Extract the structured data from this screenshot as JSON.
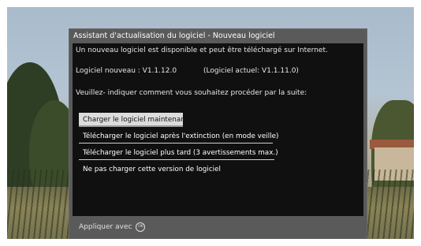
{
  "dialog": {
    "title": "Assistant d'actualisation du logiciel - Nouveau logiciel",
    "message": "Un nouveau logiciel est disponible et peut être téléchargé sur Internet.",
    "new_version_text": "Logiciel nouveau :  V1.1.12.0",
    "current_version_text": "(Logiciel actuel:  V1.1.11.0)",
    "prompt": "Veuillez- indiquer comment vous souhaitez procéder par la suite:",
    "options": [
      "Charger le logiciel maintenant",
      "Télécharger le logiciel après l'extinction (en mode veille)",
      "Télécharger le logiciel plus tard (3 avertissements max.)",
      "Ne pas charger cette version de logiciel"
    ],
    "selected_option": "Charger le logiciel maintenant",
    "footer_label": "Appliquer avec",
    "footer_icon": "ok-button-icon",
    "footer_icon_text": "OK"
  },
  "colors": {
    "dialog_frame": "#5a5a5a",
    "dialog_body": "#101010",
    "selected_option_bg": "#dcdcdc"
  }
}
